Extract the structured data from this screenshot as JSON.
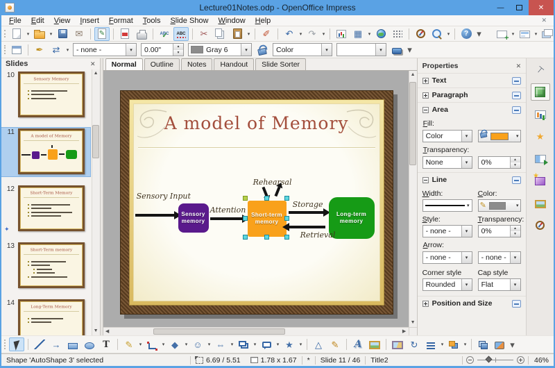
{
  "window": {
    "title": "Lecture01Notes.odp - OpenOffice Impress"
  },
  "menu": {
    "items": [
      "File",
      "Edit",
      "View",
      "Insert",
      "Format",
      "Tools",
      "Slide Show",
      "Window",
      "Help"
    ]
  },
  "toolbar_main": [
    {
      "n": "new-document",
      "k": "page",
      "dd": 1
    },
    {
      "n": "open-document",
      "k": "folder",
      "dd": 1
    },
    {
      "n": "save",
      "k": "save"
    },
    {
      "n": "email",
      "g": "✉",
      "c": "#8A7A6A"
    },
    {
      "n": "edit-file",
      "k": "pageedit",
      "g": "✎",
      "c": "#2F7D3A",
      "active": 1,
      "sep": 1
    },
    {
      "n": "export-pdf",
      "k": "pdf",
      "sep": 1
    },
    {
      "n": "print",
      "k": "print"
    },
    {
      "n": "spellcheck",
      "k": "abc",
      "g": "ABC",
      "sep": 1
    },
    {
      "n": "autospellcheck",
      "k": "abcr",
      "g": "ABC",
      "active": 1
    },
    {
      "n": "cut",
      "g": "✂",
      "c": "#A05858",
      "sep": 1
    },
    {
      "n": "copy",
      "k": "copy"
    },
    {
      "n": "paste",
      "k": "paste",
      "dd": 1
    },
    {
      "n": "format-paintbrush",
      "g": "✐",
      "c": "#C05030",
      "sep": 1
    },
    {
      "n": "undo",
      "g": "↶",
      "c": "#3465A4",
      "dd": 1,
      "sep": 1
    },
    {
      "n": "redo",
      "g": "↷",
      "c": "#9AA0A6",
      "dd": 1
    },
    {
      "n": "insert-chart",
      "k": "chart",
      "sep": 1
    },
    {
      "n": "insert-table",
      "g": "▦",
      "c": "#4470A8",
      "dd": 1
    },
    {
      "n": "hyperlink",
      "k": "globe"
    },
    {
      "n": "display-grid",
      "k": "grid"
    },
    {
      "n": "navigator",
      "k": "compass",
      "sep": 1
    },
    {
      "n": "zoom",
      "k": "zoom",
      "dd": 1
    },
    {
      "n": "help",
      "k": "help",
      "g": "?",
      "c": "#ffffff",
      "sep": 1
    },
    {
      "n": "toolbar-options",
      "g": "▾",
      "c": "#555555",
      "small": 1
    },
    {
      "n": "new-slide",
      "k": "slidenew",
      "dd": 1,
      "gap": 1
    },
    {
      "n": "slide-layout",
      "k": "layout",
      "dd": 1
    },
    {
      "n": "slide-design",
      "k": "design"
    },
    {
      "n": "slide-show",
      "k": "show",
      "sep": 1
    },
    {
      "n": "presentation-toolbar-options",
      "g": "▾",
      "c": "#555555",
      "small": 1
    }
  ],
  "toolbar_line": {
    "icons_left": [
      {
        "n": "styles-and-formatting",
        "k": "stylesfmt"
      },
      {
        "n": "line-dialog",
        "g": "✒",
        "c": "#C09020",
        "sep": 1
      },
      {
        "n": "arrowheads",
        "g": "⇄",
        "c": "#3465A4",
        "dd": 1
      }
    ],
    "line_style": "- none -",
    "line_width": "0.00\"",
    "line_color": "Gray 6",
    "fill_type": "Color",
    "icons_mid": [
      {
        "n": "area-dialog",
        "k": "can"
      }
    ],
    "icons_right": [
      {
        "n": "shadow",
        "k": "shadowrect"
      },
      {
        "n": "line-toolbar-options",
        "g": "▾",
        "c": "#555555",
        "small": 1
      }
    ]
  },
  "view_tabs": [
    "Normal",
    "Outline",
    "Notes",
    "Handout",
    "Slide Sorter"
  ],
  "slides_panel": {
    "title": "Slides",
    "slides": [
      {
        "num": "10",
        "title": "Sensory Memory",
        "kind": "bullets",
        "lines": [
          [
            72,
            0
          ],
          [
            46,
            0
          ],
          [
            50,
            0
          ]
        ]
      },
      {
        "num": "11",
        "title": "A model of Memory",
        "kind": "diagram",
        "selected": true
      },
      {
        "num": "12",
        "title": "Short-Term Memory",
        "kind": "bullets",
        "lines": [
          [
            78,
            0
          ],
          [
            40,
            0
          ],
          [
            82,
            0
          ],
          [
            60,
            0
          ]
        ],
        "animated": true
      },
      {
        "num": "13",
        "title": "Short-Term memory",
        "kind": "bullets",
        "lines": [
          [
            70,
            0
          ],
          [
            38,
            0
          ],
          [
            30,
            1
          ],
          [
            36,
            1
          ],
          [
            72,
            0
          ]
        ]
      },
      {
        "num": "14",
        "title": "Long-Term Memory",
        "kind": "bullets",
        "lines": [
          [
            64,
            0
          ],
          [
            40,
            0
          ]
        ]
      }
    ]
  },
  "slide": {
    "title": "A model of Memory",
    "labels": {
      "sensory_input": "Sensory Input",
      "attention": "Attention",
      "rehearsal": "Rehearsal",
      "storage": "Storage",
      "retrieval": "Retrieval"
    },
    "boxes": {
      "sensory": "Sensory memory",
      "short_term": "Short-term memory",
      "long_term": "Long-term memory"
    },
    "colors": {
      "sensory": "#5A1A8C",
      "short_term": "#F9A11B",
      "long_term": "#169B16",
      "title": "#A34E3C"
    }
  },
  "properties": {
    "title": "Properties",
    "sections": {
      "text": "Text",
      "paragraph": "Paragraph",
      "area": "Area",
      "line": "Line",
      "possize": "Position and Size"
    },
    "area": {
      "fill_label": "Fill:",
      "fill_type": "Color",
      "transparency_label": "Transparency:",
      "transparency_value": "None",
      "transparency_pct": "0%"
    },
    "line": {
      "width_label": "Width:",
      "color_label": "Color:",
      "style_label": "Style:",
      "style_value": "- none -",
      "transparency_label": "Transparency:",
      "transparency_pct": "0%",
      "arrow_label": "Arrow:",
      "arrow_start": "- none -",
      "arrow_end": "- none -",
      "corner_label": "Corner style",
      "corner_value": "Rounded",
      "cap_label": "Cap style",
      "cap_value": "Flat"
    }
  },
  "ui_colors": {
    "fill_swatch": "#F9A11B",
    "line_swatch": "#8C8C8C",
    "accent": "#5AA2E4"
  },
  "sidebar_tabs": [
    {
      "n": "sidebar-settings",
      "k": "pin",
      "g": "⊤"
    },
    {
      "n": "deck-properties",
      "k": "cube",
      "active": 1
    },
    {
      "n": "deck-master-pages",
      "k": "master"
    },
    {
      "n": "deck-custom-animation",
      "g": "★",
      "c": "#F0A830"
    },
    {
      "n": "deck-slide-transition",
      "k": "transition"
    },
    {
      "n": "deck-styles-and-formatting",
      "k": "styles"
    },
    {
      "n": "deck-gallery",
      "k": "pic"
    },
    {
      "n": "deck-navigator",
      "k": "compass"
    }
  ],
  "toolbar_draw": [
    {
      "n": "select",
      "k": "cursor",
      "active": 1
    },
    {
      "n": "line",
      "k": "line",
      "sep": 1
    },
    {
      "n": "arrow",
      "g": "→",
      "c": "#3465A4"
    },
    {
      "n": "rectangle",
      "k": "rect"
    },
    {
      "n": "ellipse",
      "k": "ellipse"
    },
    {
      "n": "text",
      "k": "txt",
      "g": "T",
      "c": "#333333"
    },
    {
      "n": "curve",
      "g": "✎",
      "c": "#C8A030",
      "dd": 1,
      "sep": 1
    },
    {
      "n": "connector",
      "k": "conn",
      "dd": 1
    },
    {
      "n": "basic-shapes",
      "g": "◆",
      "c": "#4470A8",
      "dd": 1
    },
    {
      "n": "symbol-shapes",
      "g": "☺",
      "c": "#4470A8",
      "dd": 1
    },
    {
      "n": "block-arrows",
      "g": "⇔",
      "c": "#4470A8",
      "dd": 1
    },
    {
      "n": "flowcharts",
      "k": "flow",
      "dd": 1
    },
    {
      "n": "callouts",
      "k": "callout",
      "dd": 1
    },
    {
      "n": "stars",
      "g": "★",
      "c": "#4470A8",
      "dd": 1
    },
    {
      "n": "edit-points",
      "g": "△",
      "c": "#3465A4",
      "sep": 1
    },
    {
      "n": "glue-points",
      "g": "✎",
      "c": "#C08820"
    },
    {
      "n": "fontwork-gallery",
      "k": "fontwork",
      "g": "A",
      "sep": 1
    },
    {
      "n": "insert-picture",
      "k": "pic"
    },
    {
      "n": "gallery",
      "k": "gallery",
      "sep": 1
    },
    {
      "n": "rotate",
      "g": "↻",
      "c": "#3465A4"
    },
    {
      "n": "alignment",
      "k": "align",
      "dd": 1
    },
    {
      "n": "arrange",
      "k": "arrange",
      "dd": 1
    },
    {
      "n": "extrusion",
      "k": "extrude",
      "sep": 1
    },
    {
      "n": "interaction",
      "k": "interact"
    },
    {
      "n": "draw-toolbar-options",
      "g": "▾",
      "c": "#555555",
      "small": 1
    }
  ],
  "statusbar": {
    "selection": "Shape 'AutoShape 3' selected",
    "position": "6.69 / 5.51",
    "size": "1.78 x 1.67",
    "modified": "*",
    "slide": "Slide 11 / 46",
    "layout": "Title2",
    "zoom": "46%"
  }
}
